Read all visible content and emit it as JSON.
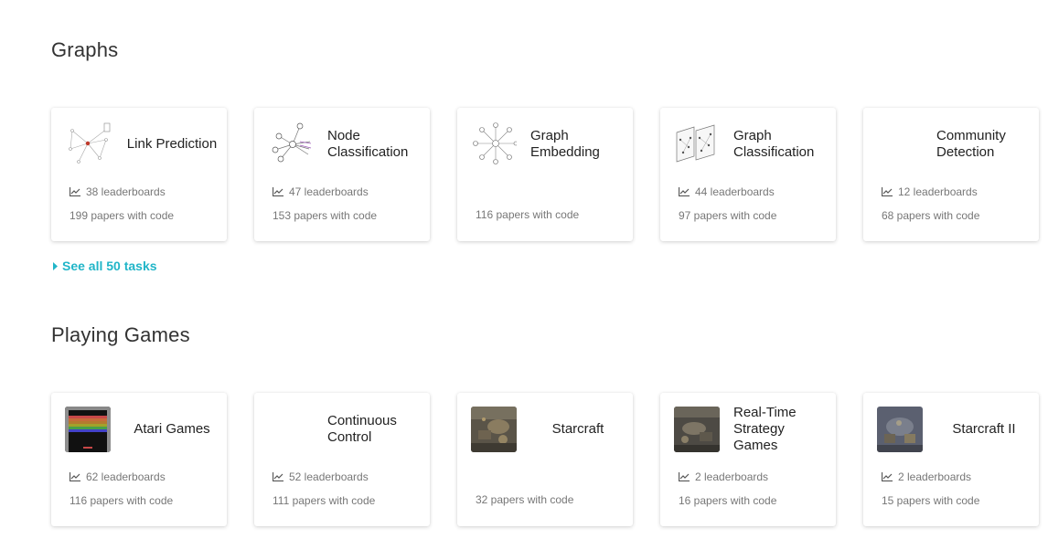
{
  "sections": [
    {
      "title": "Graphs",
      "cards": [
        {
          "title": "Link Prediction",
          "leaderboards": "38 leaderboards",
          "papers": "199 papers with code",
          "thumb": "link-prediction-graph-icon"
        },
        {
          "title": "Node Classification",
          "leaderboards": "47 leaderboards",
          "papers": "153 papers with code",
          "thumb": "node-graph-icon"
        },
        {
          "title": "Graph Embedding",
          "leaderboards": "",
          "papers": "116 papers with code",
          "thumb": "star-graph-icon"
        },
        {
          "title": "Graph Classification",
          "leaderboards": "44 leaderboards",
          "papers": "97 papers with code",
          "thumb": "graph-layers-icon"
        },
        {
          "title": "Community Detection",
          "leaderboards": "12 leaderboards",
          "papers": "68 papers with code",
          "thumb": ""
        }
      ],
      "see_all": "See all 50 tasks"
    },
    {
      "title": "Playing Games",
      "cards": [
        {
          "title": "Atari Games",
          "leaderboards": "62 leaderboards",
          "papers": "116 papers with code",
          "thumb": "atari-breakout-image"
        },
        {
          "title": "Continuous Control",
          "leaderboards": "52 leaderboards",
          "papers": "111 papers with code",
          "thumb": ""
        },
        {
          "title": "Starcraft",
          "leaderboards": "",
          "papers": "32 papers with code",
          "thumb": "starcraft-screenshot-image"
        },
        {
          "title": "Real-Time Strategy Games",
          "leaderboards": "2 leaderboards",
          "papers": "16 papers with code",
          "thumb": "rts-screenshot-image"
        },
        {
          "title": "Starcraft II",
          "leaderboards": "2 leaderboards",
          "papers": "15 papers with code",
          "thumb": "starcraft2-screenshot-image"
        }
      ]
    }
  ],
  "colors": {
    "accent": "#21b5c8",
    "muted_text": "#777777",
    "card_bg": "#ffffff"
  }
}
